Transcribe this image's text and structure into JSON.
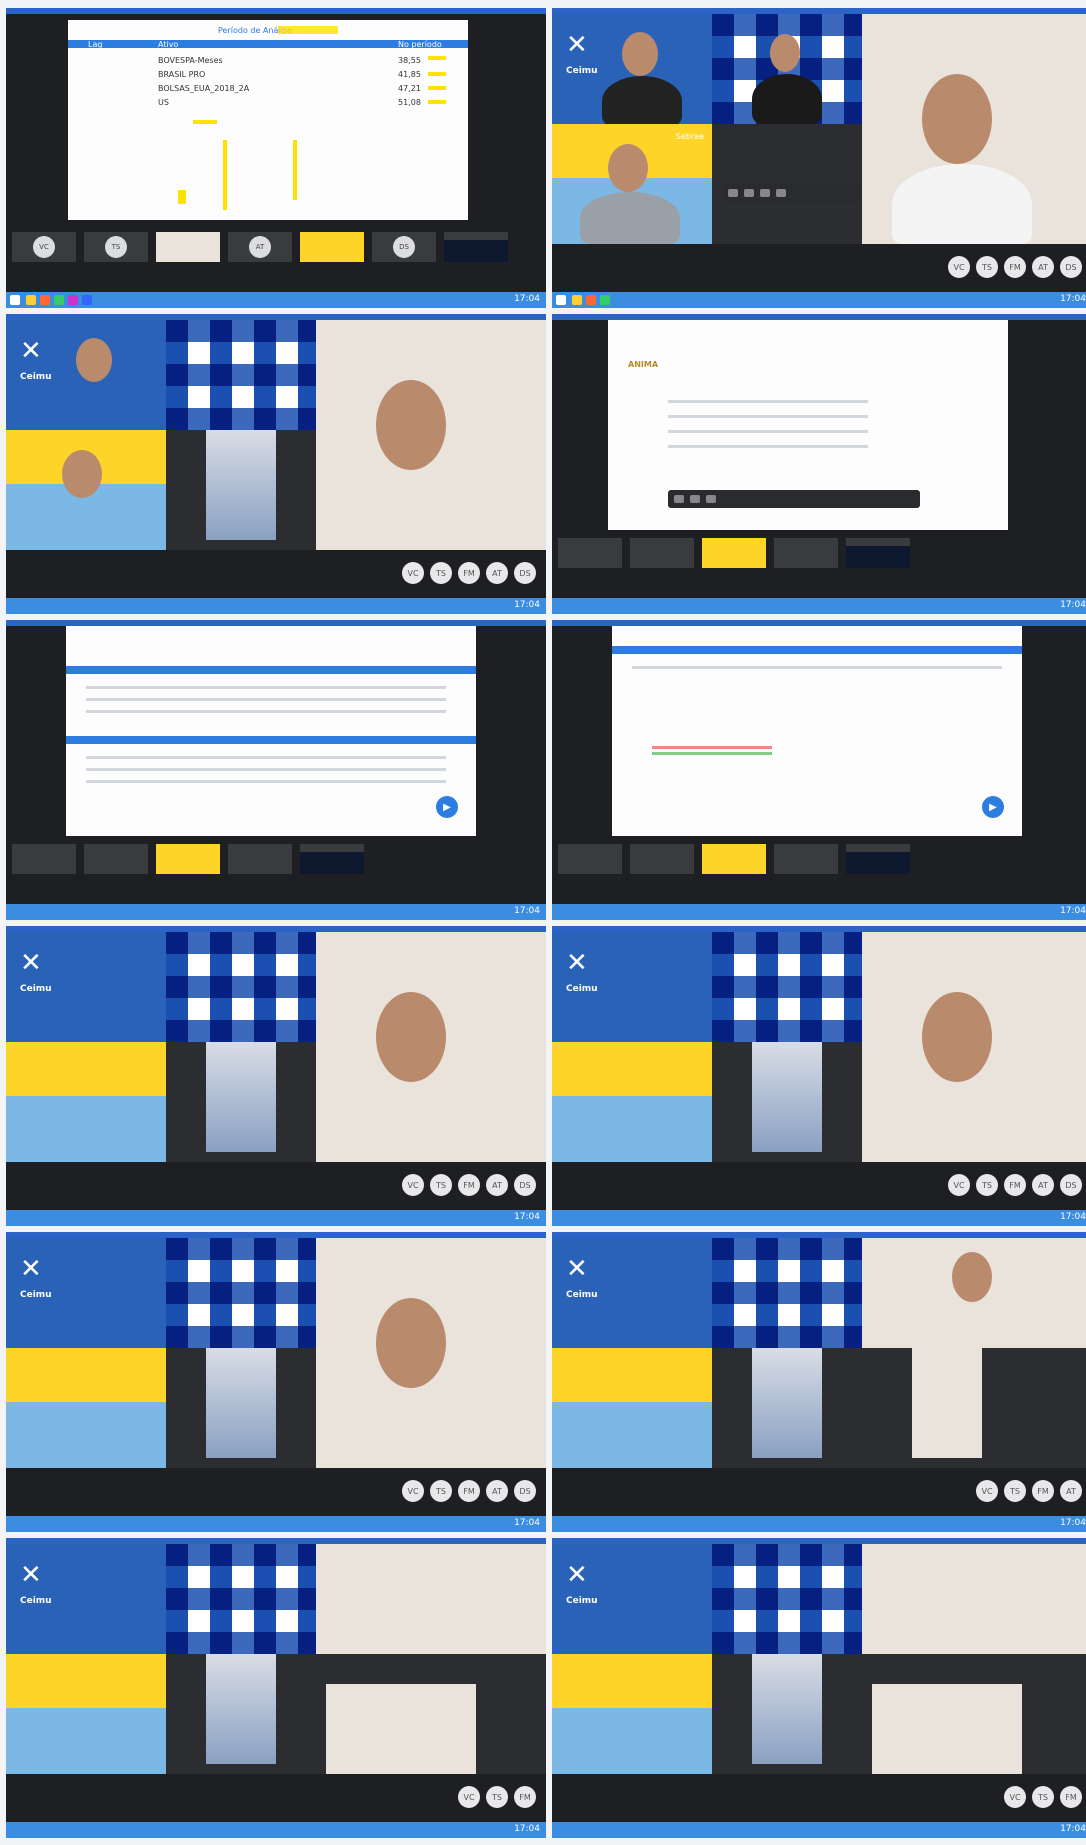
{
  "brand": {
    "logo_text": "Ceimu",
    "brand_mark": "Sebrae"
  },
  "taskbar": {
    "clock": "17:04"
  },
  "controls": {
    "labels": [
      "VC",
      "TS",
      "FM",
      "AT",
      "DS"
    ]
  },
  "screenshare_1": {
    "title": "Período de Análise",
    "col_headers": [
      "Lag",
      "Ativo",
      "No período"
    ],
    "rows": [
      {
        "ativo": "BOVESPA-Meses",
        "val": "38,55"
      },
      {
        "ativo": "BRASIL PRO",
        "val": "41,85"
      },
      {
        "ativo": "BOLSAS_EUA_2018_2A",
        "val": "47,21"
      },
      {
        "ativo": "US",
        "val": "51,08"
      }
    ]
  },
  "screenshare_3": {
    "logo": "ANIMA"
  },
  "colors": {
    "accent": "#2b63c7",
    "taskbar": "#3a8de0",
    "highlight": "#ffe100",
    "brand_yellow": "#ffd429"
  }
}
